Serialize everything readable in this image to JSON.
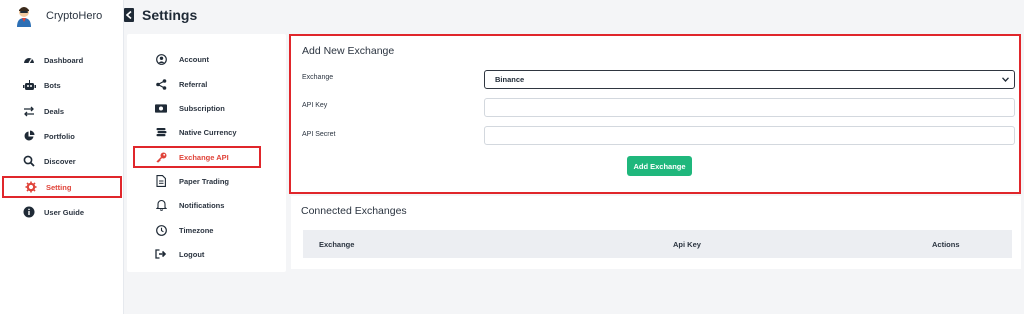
{
  "brand": {
    "name": "CryptoHero"
  },
  "sidebar": {
    "items": [
      {
        "label": "Dashboard",
        "icon": "dashboard-gauge-icon"
      },
      {
        "label": "Bots",
        "icon": "robot-icon"
      },
      {
        "label": "Deals",
        "icon": "arrows-exchange-icon"
      },
      {
        "label": "Portfolio",
        "icon": "pie-chart-icon"
      },
      {
        "label": "Discover",
        "icon": "search-icon"
      },
      {
        "label": "Setting",
        "icon": "gear-icon",
        "active": true
      },
      {
        "label": "User Guide",
        "icon": "info-icon"
      }
    ]
  },
  "header": {
    "title": "Settings"
  },
  "settings_nav": {
    "items": [
      {
        "label": "Account",
        "icon": "user-circle-icon"
      },
      {
        "label": "Referral",
        "icon": "share-icon"
      },
      {
        "label": "Subscription",
        "icon": "money-icon"
      },
      {
        "label": "Native Currency",
        "icon": "coins-icon"
      },
      {
        "label": "Exchange API",
        "icon": "key-icon",
        "active": true
      },
      {
        "label": "Paper Trading",
        "icon": "document-icon"
      },
      {
        "label": "Notifications",
        "icon": "bell-icon"
      },
      {
        "label": "Timezone",
        "icon": "clock-icon"
      },
      {
        "label": "Logout",
        "icon": "logout-icon"
      }
    ]
  },
  "add_exchange": {
    "title": "Add New Exchange",
    "exchange_label": "Exchange",
    "exchange_value": "Binance",
    "api_key_label": "API Key",
    "api_key_value": "",
    "api_secret_label": "API Secret",
    "api_secret_value": "",
    "submit_label": "Add Exchange"
  },
  "connected": {
    "title": "Connected Exchanges",
    "columns": [
      "Exchange",
      "Api Key",
      "Actions"
    ]
  },
  "colors": {
    "accent_red": "#e0262b",
    "active_text": "#e0443a",
    "button_green": "#1fb77c",
    "background": "#f4f5f7"
  }
}
